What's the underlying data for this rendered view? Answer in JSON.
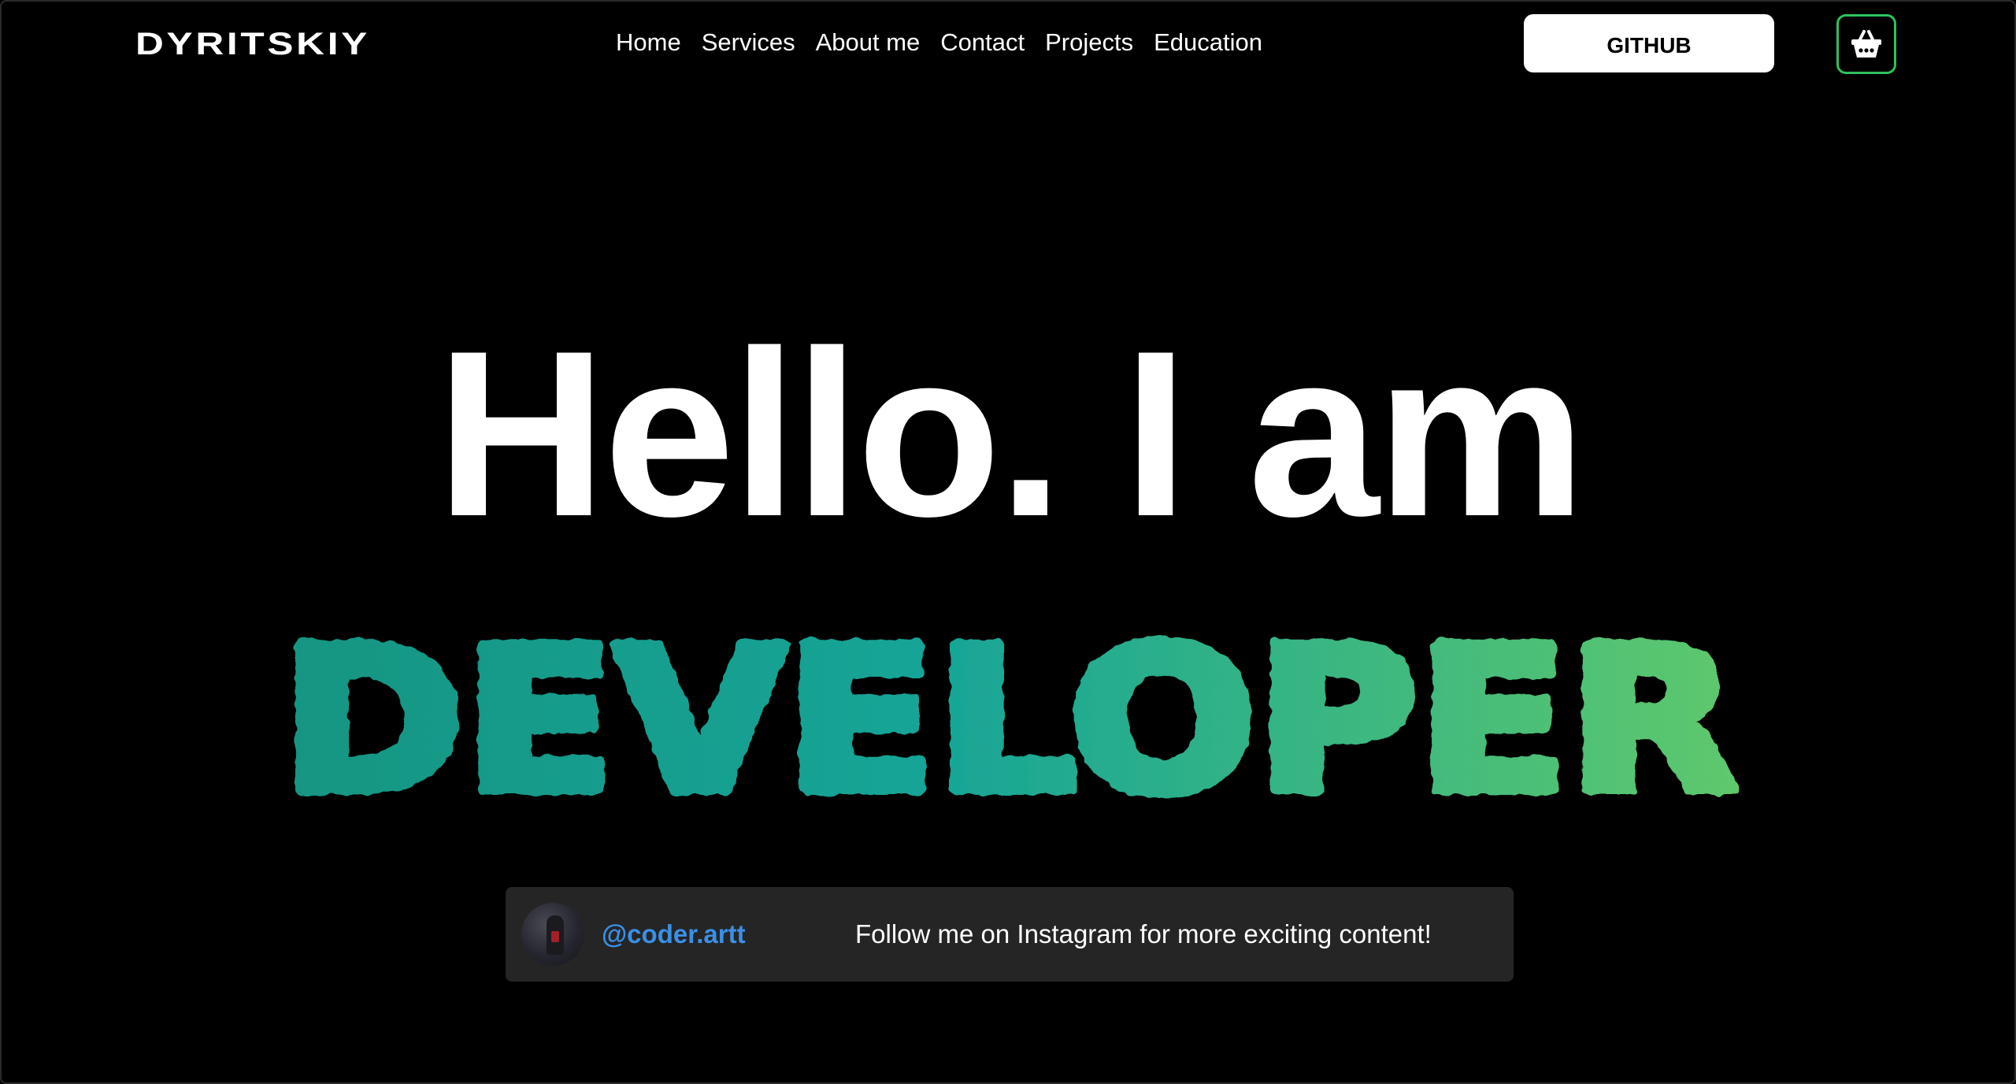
{
  "header": {
    "logo_text": "DYRITSKIY",
    "nav": [
      {
        "label": "Home"
      },
      {
        "label": "Services"
      },
      {
        "label": "About me"
      },
      {
        "label": "Contact"
      },
      {
        "label": "Projects"
      },
      {
        "label": "Education"
      }
    ],
    "github_label": "GITHUB",
    "cart_icon": "basket-icon"
  },
  "hero": {
    "greeting": "Hello. I am",
    "role": "DEVELOPER",
    "role_gradient": [
      "#129582",
      "#17a597",
      "#5ec86c"
    ]
  },
  "instagram": {
    "handle": "@coder.artt",
    "message": "Follow me on Instagram for more exciting content!"
  },
  "colors": {
    "background": "#000000",
    "accent_green": "#2ec25c",
    "handle_blue": "#3b8fe6",
    "banner_bg": "#252525"
  }
}
